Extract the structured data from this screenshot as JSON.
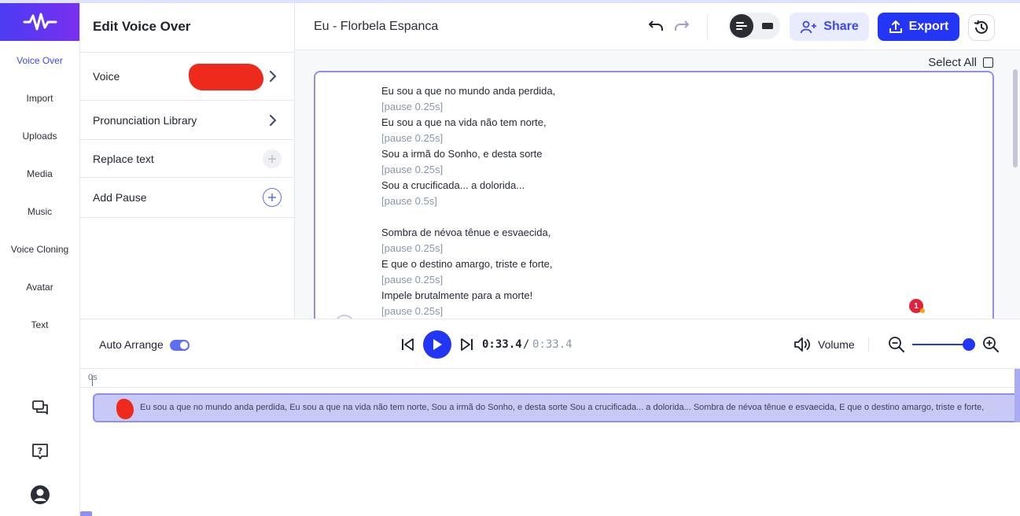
{
  "rail": {
    "items": [
      "Voice Over",
      "Import",
      "Uploads",
      "Media",
      "Music",
      "Voice Cloning",
      "Avatar",
      "Text"
    ],
    "active": "Voice Over",
    "bottom_icons": [
      "chat-bubbles-icon",
      "help-icon",
      "user-profile-icon"
    ]
  },
  "panel": {
    "title": "Edit Voice Over",
    "rows": {
      "voice": "Voice",
      "pronunciation": "Pronunciation Library",
      "replace": "Replace text",
      "pause": "Add Pause"
    }
  },
  "header": {
    "project_title": "Eu - Florbela Espanca",
    "share_label": "Share",
    "export_label": "Export",
    "accent": "#2335f5"
  },
  "script": {
    "select_all": "Select All",
    "lines": [
      {
        "text": "Eu sou a que no mundo anda perdida,",
        "kind": "text"
      },
      {
        "text": "[pause 0.25s]",
        "kind": "pause"
      },
      {
        "text": "Eu sou a que na vida não tem norte,",
        "kind": "text"
      },
      {
        "text": "[pause 0.25s]",
        "kind": "pause"
      },
      {
        "text": "Sou a irmã do Sonho, e desta sorte",
        "kind": "text"
      },
      {
        "text": "[pause 0.25s]",
        "kind": "pause"
      },
      {
        "text": "Sou a crucificada... a dolorida...",
        "kind": "text"
      },
      {
        "text": "[pause 0.5s]",
        "kind": "pause"
      },
      {
        "text": "",
        "kind": "blank"
      },
      {
        "text": "Sombra de névoa tênue e esvaecida,",
        "kind": "text"
      },
      {
        "text": "[pause 0.25s]",
        "kind": "pause"
      },
      {
        "text": "E que o destino amargo, triste e forte,",
        "kind": "text"
      },
      {
        "text": "[pause 0.25s]",
        "kind": "pause"
      },
      {
        "text": "Impele brutalmente para a morte!",
        "kind": "text"
      },
      {
        "text": "[pause 0.25s]",
        "kind": "pause"
      }
    ],
    "notification_count": "1"
  },
  "player": {
    "auto_arrange": "Auto Arrange",
    "auto_arrange_on": true,
    "current_time": "0:33.4",
    "separator": "/",
    "total_time": "0:33.4",
    "volume_label": "Volume",
    "zoom_level": 0.97
  },
  "timeline": {
    "ruler_start": "0s",
    "clip_text": "Eu sou a que no mundo anda perdida, Eu sou a que na vida não tem norte, Sou a irmã do Sonho, e desta sorte Sou a crucificada... a dolorida... Sombra de névoa tênue e esvaecida, E que o destino amargo, triste e forte,"
  }
}
